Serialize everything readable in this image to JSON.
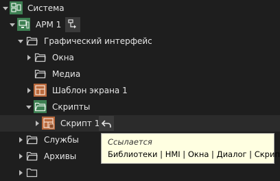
{
  "tree": {
    "root": {
      "label": "Система",
      "icon": "system-icon"
    },
    "arm": {
      "label": "АРМ 1",
      "icon": "workstation-icon",
      "action_icon": "tree-structure-icon"
    },
    "gui": {
      "label": "Графический интерфейс",
      "icon": "folder-icon"
    },
    "windows": {
      "label": "Окна",
      "icon": "folder-icon"
    },
    "media": {
      "label": "Медиа",
      "icon": "folder-icon"
    },
    "screen_template": {
      "label": "Шаблон экрана 1",
      "icon": "screen-template-icon"
    },
    "scripts": {
      "label": "Скрипты",
      "icon": "folder-icon"
    },
    "script1": {
      "label": "Скрипт 1",
      "icon": "script-icon",
      "action_icon": "back-reference-icon"
    },
    "services": {
      "label": "Службы",
      "icon": "folder-icon"
    },
    "archives": {
      "label": "Архивы",
      "icon": "folder-icon"
    }
  },
  "tooltip": {
    "title": "Ссылается",
    "text": "Библиотеки | HMI | Окна | Диалог | Скрипт"
  },
  "colors": {
    "background": "#1e1e1e",
    "green_icon": "#3d7f52",
    "orange_icon": "#b9693c",
    "tooltip_bg": "#ffffe1"
  }
}
